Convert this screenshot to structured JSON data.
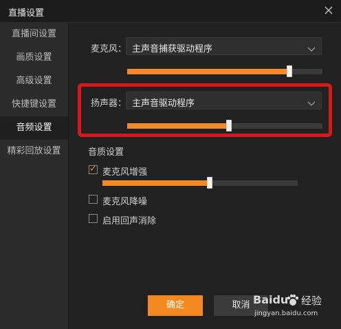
{
  "window": {
    "title": "直播设置"
  },
  "sidebar": {
    "items": [
      {
        "label": "直播间设置"
      },
      {
        "label": "画质设置"
      },
      {
        "label": "高级设置"
      },
      {
        "label": "快捷键设置"
      },
      {
        "label": "音频设置",
        "active": true
      },
      {
        "label": "精彩回放设置"
      }
    ]
  },
  "microphone": {
    "label": "麦克风：",
    "device": "主声音捕获驱动程序",
    "volume_percent": 83
  },
  "speaker": {
    "label": "扬声器：",
    "device": "主声音驱动程序",
    "volume_percent": 52
  },
  "quality": {
    "section_label": "音质设置",
    "enhance": {
      "label": "麦克风增强",
      "checked": true,
      "level_percent": 55
    },
    "noise_reduction": {
      "label": "麦克风降噪",
      "checked": false
    },
    "echo_cancel": {
      "label": "启用回声消除",
      "checked": false
    }
  },
  "buttons": {
    "ok": "确定",
    "cancel": "取消"
  },
  "watermark": {
    "brand": "Baidu",
    "brand_suffix": "经验",
    "url": "jingyan.baidu.com"
  },
  "colors": {
    "accent": "#f28a25",
    "highlight": "#d91919"
  }
}
